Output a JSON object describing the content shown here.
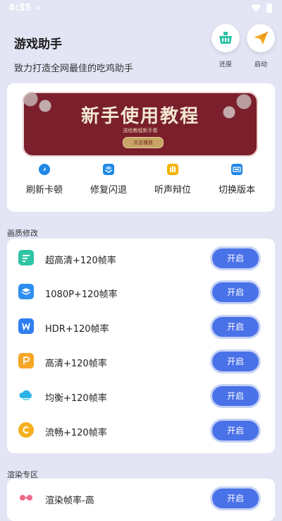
{
  "status_bar": {
    "time": "4:35",
    "dismiss": "×"
  },
  "header": {
    "title": "游戏助手",
    "subtitle": "致力打造全网最佳的吃鸡助手",
    "restore_label": "还原",
    "launch_label": "启动"
  },
  "banner": {
    "title": "新手使用教程",
    "subtitle": "送给教程新手看",
    "button": "点击播放"
  },
  "quick_actions": [
    {
      "label": "刷新卡顿",
      "icon": "refresh-app-icon",
      "color": "#1e88e5"
    },
    {
      "label": "修复闪退",
      "icon": "layers-icon",
      "color": "#1e88e5"
    },
    {
      "label": "听声辩位",
      "icon": "hand-icon",
      "color": "#f4b400"
    },
    {
      "label": "切换版本",
      "icon": "switch-icon",
      "color": "#1e88e5"
    }
  ],
  "sections": {
    "quality": "画质修改",
    "render": "渲染专区"
  },
  "quality_options": [
    {
      "name": "超高清+120帧率",
      "button": "开启",
      "icon": "chart-icon",
      "color": "#2ec4a6"
    },
    {
      "name": "1080P+120帧率",
      "button": "开启",
      "icon": "layers-icon",
      "color": "#2f8ff0"
    },
    {
      "name": "HDR+120帧率",
      "button": "开启",
      "icon": "w-badge-icon",
      "color": "#2f7ff0"
    },
    {
      "name": "高清+120帧率",
      "button": "开启",
      "icon": "p-badge-icon",
      "color": "#f5a623"
    },
    {
      "name": "均衡+120帧率",
      "button": "开启",
      "icon": "cloud-icon",
      "color": "#2bb4e6"
    },
    {
      "name": "流畅+120帧率",
      "button": "开启",
      "icon": "circle-c-icon",
      "color": "#f5b021"
    }
  ],
  "render_options": [
    {
      "name": "渲染帧率-高",
      "button": "开启",
      "icon": "glasses-icon",
      "color": "#ef6a8a"
    }
  ],
  "colors": {
    "accent": "#4a72e8",
    "background": "#e3e5f5",
    "banner": "#7a1f2b"
  }
}
